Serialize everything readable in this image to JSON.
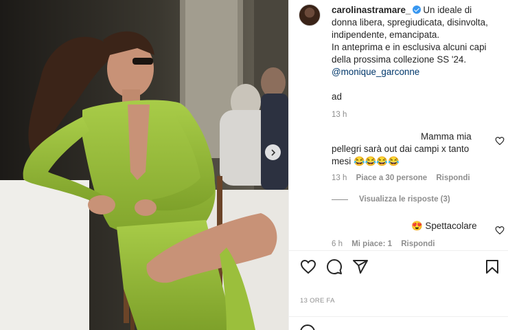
{
  "post": {
    "photo_alt": "",
    "next_label": "›"
  },
  "caption": {
    "username": "carolinastramare_",
    "text_lines": [
      "Un ideale di",
      "donna libera, spregiudicata, disinvolta,",
      "indipendente, emancipata.",
      "In anteprima e in esclusiva alcuni capi",
      "della prossima collezione SS '24."
    ],
    "mention": "@monique_garconne",
    "ad": "ad",
    "time": "13 h"
  },
  "comments": [
    {
      "text_lines": [
        "Mamma mia",
        "pellegri sarà out dai campi x tanto",
        "mesi 😂😂😂😂"
      ],
      "time": "13 h",
      "likes": "Piace a 30 persone",
      "reply": "Rispondi"
    },
    {
      "text": "😍 Spettacolare",
      "time": "6 h",
      "likes": "Mi piace: 1",
      "reply": "Rispondi"
    }
  ],
  "replies_toggle": "Visualizza le risposte (3)",
  "post_time": "13 ORE FA",
  "icons": {
    "like": "heart-icon",
    "comment": "comment-icon",
    "share": "share-icon",
    "save": "bookmark-icon"
  },
  "colors": {
    "dress": "#9bc23a",
    "verified": "#3897f0",
    "mention": "#00376b"
  }
}
